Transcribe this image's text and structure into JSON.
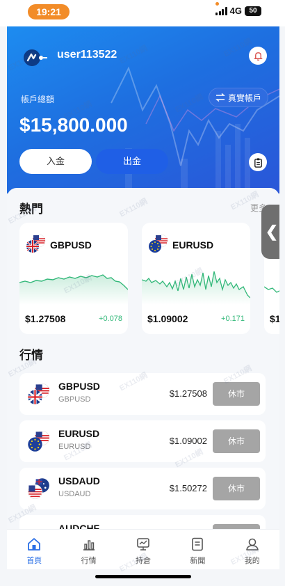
{
  "status_bar": {
    "time": "19:21",
    "network": "4G",
    "battery": "50"
  },
  "header": {
    "username": "user113522",
    "account_label": "帳戶總額",
    "balance": "$15,800.000",
    "real_account_label": "真實帳戶",
    "deposit_label": "入金",
    "withdraw_label": "出金"
  },
  "hot": {
    "title": "熱門",
    "more": "更多",
    "cards": [
      {
        "symbol": "GBPUSD",
        "price": "$1.27508",
        "change": "+0.078"
      },
      {
        "symbol": "EURUSD",
        "price": "$1.09002",
        "change": "+0.171"
      },
      {
        "symbol": "",
        "price": "$1",
        "change": ""
      }
    ]
  },
  "market": {
    "title": "行情",
    "rows": [
      {
        "symbol": "GBPUSD",
        "sub": "GBPUSD",
        "price": "$1.27508",
        "status": "休市"
      },
      {
        "symbol": "EURUSD",
        "sub": "EURUSD",
        "price": "$1.09002",
        "status": "休市"
      },
      {
        "symbol": "USDAUD",
        "sub": "USDAUD",
        "price": "$1.50272",
        "status": "休市"
      },
      {
        "symbol": "AUDCHF",
        "sub": "",
        "price": "",
        "status": ""
      }
    ]
  },
  "nav": [
    {
      "label": "首頁",
      "icon": "home-icon",
      "active": true
    },
    {
      "label": "行情",
      "icon": "bar-chart-icon",
      "active": false
    },
    {
      "label": "持倉",
      "icon": "monitor-icon",
      "active": false
    },
    {
      "label": "新聞",
      "icon": "document-icon",
      "active": false
    },
    {
      "label": "我的",
      "icon": "user-icon",
      "active": false
    }
  ],
  "watermark": "EX110網",
  "colors": {
    "accent": "#2a6fe6",
    "header_start": "#1d8cf0",
    "up": "#32b879",
    "closed": "#a5a5a5",
    "time_pill": "#f28c28"
  }
}
